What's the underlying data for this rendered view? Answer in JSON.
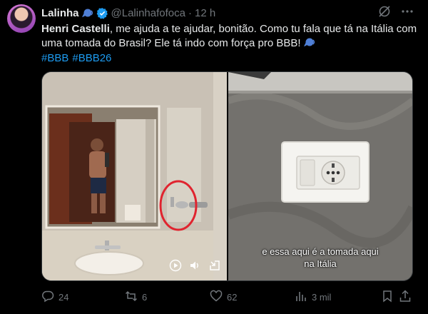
{
  "author": {
    "name": "Lalinha",
    "handle": "@Lalinhafofoca",
    "separator": "·",
    "time": "12 h"
  },
  "tweet": {
    "mention": "Henri Castelli",
    "body": ", me ajuda a te ajudar, bonitão. Como tu fala que tá na Itália com uma tomada do Brasil? Ele tá indo com força pro BBB!",
    "hashtags": [
      "#BBB",
      "#BBB26"
    ]
  },
  "media": {
    "right_caption_line1": "e essa aqui é a tomada aqui",
    "right_caption_line2": "na Itália"
  },
  "actions": {
    "replies": "24",
    "reposts": "6",
    "likes": "62",
    "views": "3 mil"
  },
  "colors": {
    "accent": "#1d9bf0",
    "muted": "#71767b",
    "text": "#e7e9ea",
    "background": "#000000",
    "highlight_circle": "#e0242f"
  },
  "icons": [
    "speech-bubble-icon",
    "verified-badge-icon",
    "grok-icon",
    "more-icon",
    "play-icon",
    "volume-icon",
    "exit-fullscreen-icon",
    "reply-icon",
    "repost-icon",
    "like-icon",
    "views-icon",
    "bookmark-icon",
    "share-icon"
  ]
}
